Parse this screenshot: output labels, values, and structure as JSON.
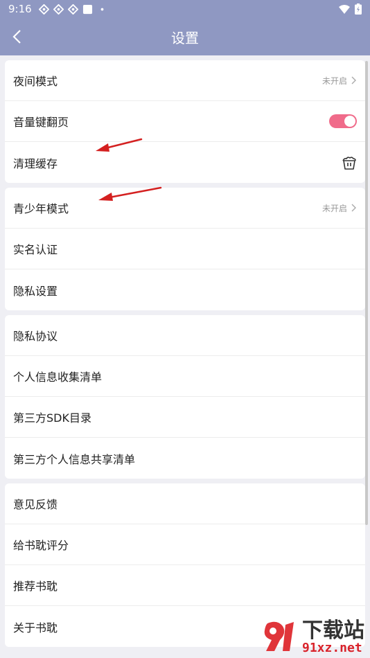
{
  "statusbar": {
    "time": "9:16"
  },
  "header": {
    "title": "设置"
  },
  "groups": [
    {
      "items": [
        {
          "label": "夜间模式",
          "status": "未开启"
        },
        {
          "label": "音量键翻页",
          "toggle": true
        },
        {
          "label": "清理缓存",
          "icon": "trash-bin-icon"
        }
      ]
    },
    {
      "items": [
        {
          "label": "青少年模式",
          "status": "未开启"
        },
        {
          "label": "实名认证"
        },
        {
          "label": "隐私设置"
        }
      ]
    },
    {
      "items": [
        {
          "label": "隐私协议"
        },
        {
          "label": "个人信息收集清单"
        },
        {
          "label": "第三方SDK目录"
        },
        {
          "label": "第三方个人信息共享清单"
        }
      ]
    },
    {
      "items": [
        {
          "label": "意见反馈"
        },
        {
          "label": "给书耽评分"
        },
        {
          "label": "推荐书耽"
        },
        {
          "label": "关于书耽"
        }
      ]
    }
  ],
  "watermark": {
    "main": "下载站",
    "sub": "91xz.net"
  },
  "colors": {
    "header": "#8f98c2",
    "toggle_on": "#f06b8a",
    "arrow": "#d42020"
  }
}
